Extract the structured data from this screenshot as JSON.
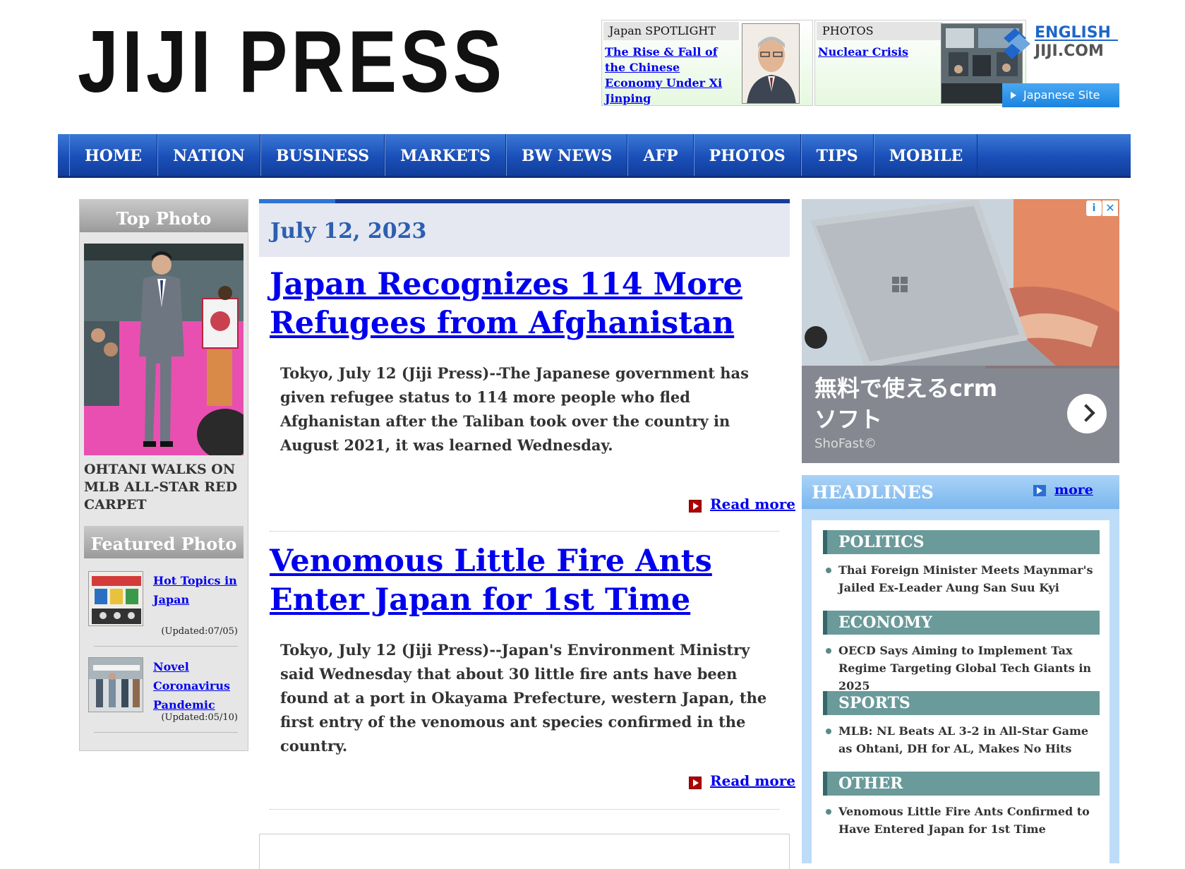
{
  "header": {
    "logo": "JIJI PRESS",
    "spotlight": {
      "label": "Japan SPOTLIGHT",
      "link": "The Rise & Fall of the Chinese Economy Under Xi Jinping"
    },
    "photos": {
      "label": "PHOTOS",
      "link": "Nuclear Crisis"
    },
    "english_logo_top": "ENGLISH",
    "english_logo_bottom": "JIJI.COM",
    "japanese_site": "Japanese Site"
  },
  "nav": [
    "HOME",
    "NATION",
    "BUSINESS",
    "MARKETS",
    "BW NEWS",
    "AFP",
    "PHOTOS",
    "TIPS",
    "MOBILE"
  ],
  "left": {
    "top_photo_title": "Top Photo",
    "top_photo_caption": "OHTANI WALKS ON MLB ALL-STAR RED CARPET",
    "featured_title": "Featured Photo",
    "featured": [
      {
        "title": "Hot Topics in Japan",
        "updated": "(Updated:07/05)"
      },
      {
        "title": "Novel Coronavirus Pandemic",
        "updated": "(Updated:05/10)"
      }
    ]
  },
  "main": {
    "date": "July 12, 2023",
    "read_more": "Read more",
    "articles": [
      {
        "title": "Japan Recognizes 114 More Refugees from Afghanistan",
        "body": "Tokyo, July 12 (Jiji Press)--The Japanese government has given refugee status to 114 more people who fled Afghanistan after the Taliban took over the country in August 2021, it was learned Wednesday."
      },
      {
        "title": "Venomous Little Fire Ants Enter Japan for 1st Time",
        "body": "Tokyo, July 12 (Jiji Press)--Japan's Environment Ministry said Wednesday that about 30 little fire ants have been found at a port in Okayama Prefecture, western Japan, the first entry of the venomous ant species confirmed in the country."
      }
    ]
  },
  "ad": {
    "text_line1": "無料で使えるcrm",
    "text_line2": "ソフト",
    "source": "ShoFast©",
    "info": "i",
    "close": "✕"
  },
  "headlines": {
    "title": "HEADLINES",
    "more": "more",
    "categories": [
      {
        "name": "POLITICS",
        "item": "Thai Foreign Minister Meets Maynmar's Jailed Ex-Leader Aung San Suu Kyi"
      },
      {
        "name": "ECONOMY",
        "item": "OECD Says Aiming to Implement Tax Regime Targeting Global Tech Giants in 2025"
      },
      {
        "name": "SPORTS",
        "item": "MLB: NL Beats AL 3-2 in All-Star Game as Ohtani, DH for AL, Makes No Hits"
      },
      {
        "name": "OTHER",
        "item": "Venomous Little Fire Ants Confirmed to Have Entered Japan for 1st Time"
      }
    ]
  }
}
